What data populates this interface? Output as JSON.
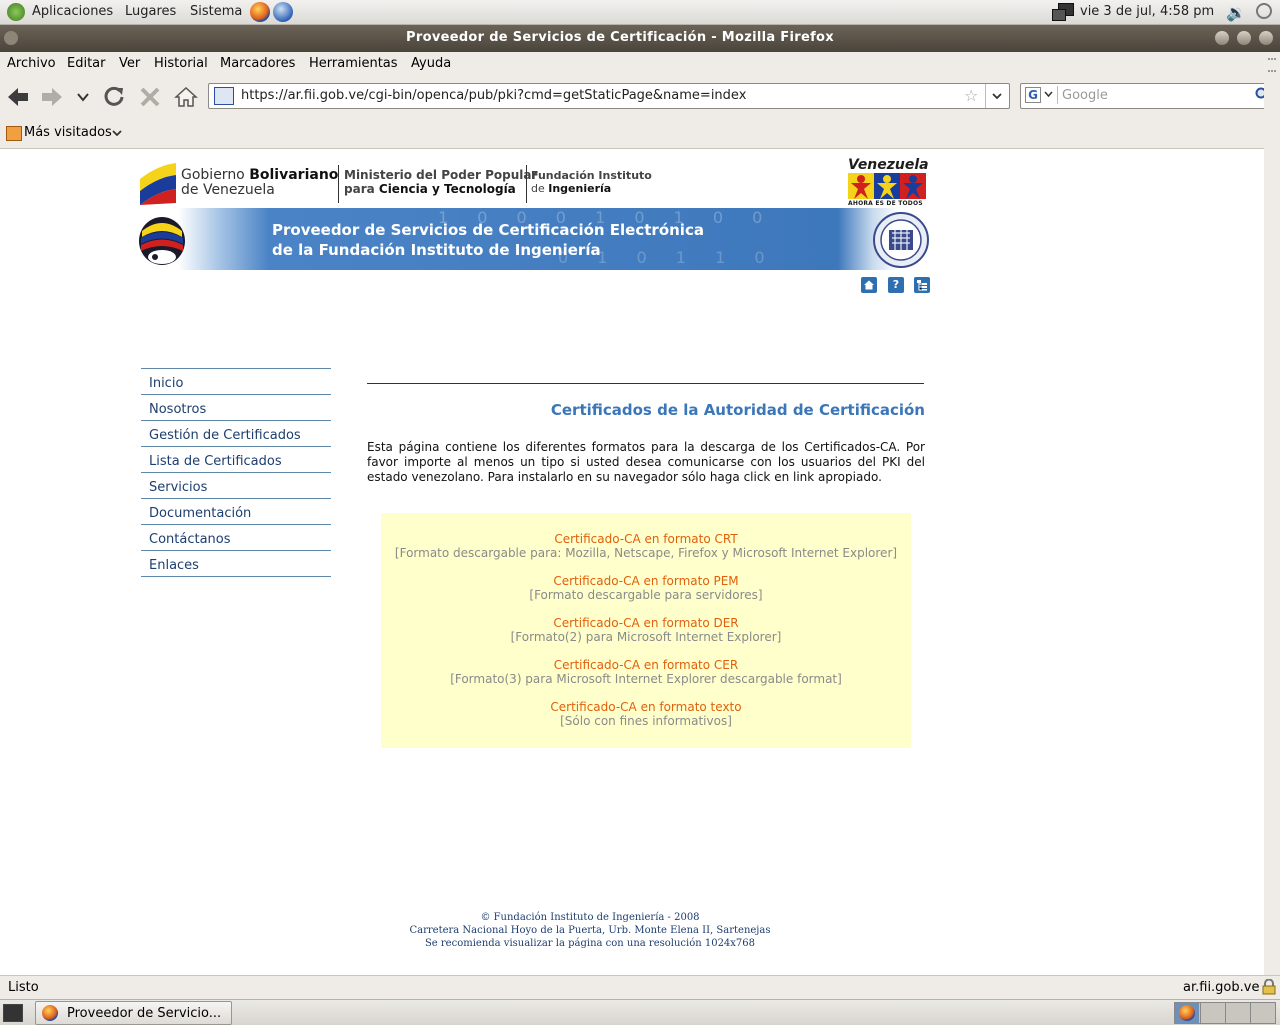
{
  "panel": {
    "menus": [
      "Aplicaciones",
      "Lugares",
      "Sistema"
    ],
    "clock": "vie  3 de jul,  4:58 pm"
  },
  "window": {
    "title": "Proveedor de Servicios de Certificación - Mozilla Firefox"
  },
  "menubar": [
    "Archivo",
    "Editar",
    "Ver",
    "Historial",
    "Marcadores",
    "Herramientas",
    "Ayuda"
  ],
  "navbar": {
    "url": "https://ar.fii.gob.ve/cgi-bin/openca/pub/pki?cmd=getStaticPage&name=index",
    "search_placeholder": "Google"
  },
  "bookmarks": {
    "most_visited": "Más visitados"
  },
  "header": {
    "gov_line1_a": "Gobierno ",
    "gov_line1_b": "Bolivariano",
    "gov_line2": "de Venezuela",
    "ministry_line1": "Ministerio del Poder Popular",
    "ministry_line2_a": "para ",
    "ministry_line2_b": "Ciencia y Tecnología",
    "fii_line1": "Fundación Instituto",
    "fii_line2_a": "de ",
    "fii_line2_b": "Ingeniería",
    "venezuela": "Venezuela",
    "venezuela_tag": "AHORA ES DE TODOS",
    "banner_line1": "Proveedor de Servicios de Certificación Electrónica",
    "banner_line2": "de la Fundación Instituto de Ingeniería"
  },
  "sidebar": [
    "Inicio",
    "Nosotros",
    "Gestión de Certificados",
    "Lista de Certificados",
    "Servicios",
    "Documentación",
    "Contáctanos",
    "Enlaces"
  ],
  "main": {
    "heading": "Certificados de la Autoridad de Certificación",
    "intro": "Esta página contiene los diferentes formatos para la descarga de los Certificados-CA. Por favor importe al menos un tipo si usted desea comunicarse con los usuarios del PKI del estado venezolano. Para instalarlo en su navegador sólo haga click en link apropiado.",
    "downloads": [
      {
        "title": "Certificado-CA en formato CRT",
        "desc": "[Formato descargable para: Mozilla, Netscape, Firefox y Microsoft Internet Explorer]"
      },
      {
        "title": "Certificado-CA en formato PEM",
        "desc": "[Formato descargable para servidores]"
      },
      {
        "title": "Certificado-CA en formato DER",
        "desc": "[Formato(2) para Microsoft Internet Explorer]"
      },
      {
        "title": "Certificado-CA en formato CER",
        "desc": "[Formato(3) para Microsoft Internet Explorer descargable format]"
      },
      {
        "title": "Certificado-CA en formato texto",
        "desc": "[Sólo con fines informativos]"
      }
    ]
  },
  "footer": {
    "line1": "© Fundación Instituto de Ingeniería - 2008",
    "line2": "Carretera Nacional Hoyo de la Puerta, Urb. Monte Elena II, Sartenejas",
    "line3": "Se recomienda visualizar la página con una resolución 1024x768"
  },
  "status": {
    "left": "Listo",
    "right": "ar.fii.gob.ve"
  },
  "taskbar": {
    "task": "Proveedor de Servicio..."
  },
  "colors": {
    "link_orange": "#e0600e",
    "heading_blue": "#3a76b8",
    "panel_yellow": "#ffffcc",
    "nav_blue": "#1d3e6e"
  }
}
